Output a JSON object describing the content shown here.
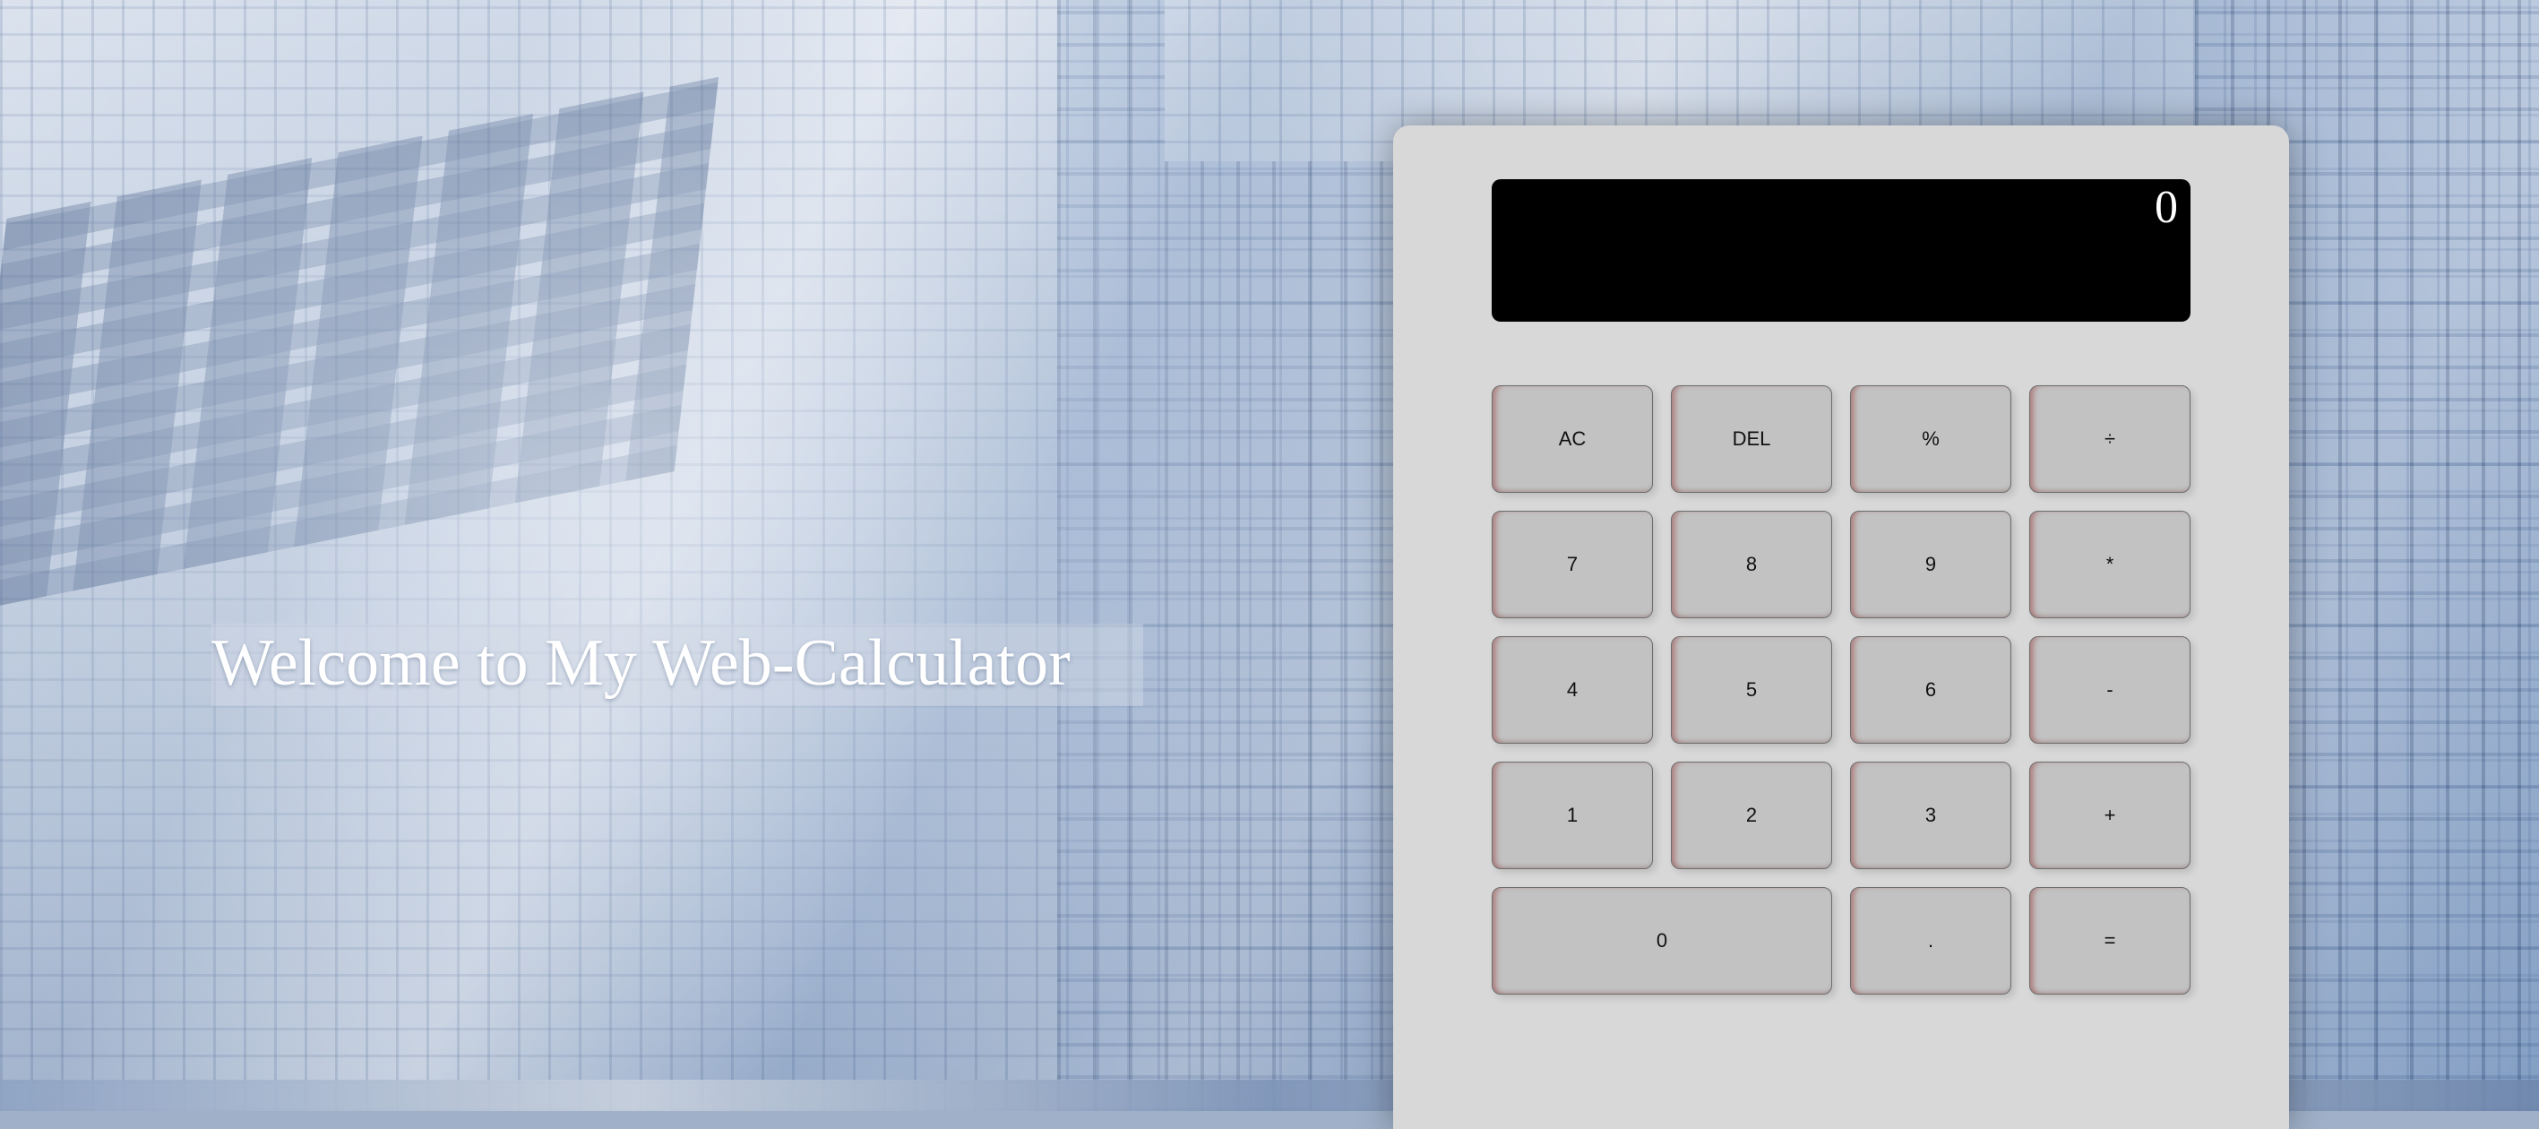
{
  "page": {
    "welcome_text": "Welcome to My Web-Calculator"
  },
  "calculator": {
    "display_value": "0",
    "keys": {
      "ac": "AC",
      "del": "DEL",
      "percent": "%",
      "divide": "÷",
      "seven": "7",
      "eight": "8",
      "nine": "9",
      "multiply": "*",
      "four": "4",
      "five": "5",
      "six": "6",
      "subtract": "-",
      "one": "1",
      "two": "2",
      "three": "3",
      "add": "+",
      "zero": "0",
      "decimal": ".",
      "equals": "="
    }
  },
  "colors": {
    "calculator_body": "#d8d8d8",
    "display_background": "#000000",
    "display_text": "#ffffff",
    "key_background": "#c2c2c2",
    "welcome_text": "#ffffff"
  }
}
